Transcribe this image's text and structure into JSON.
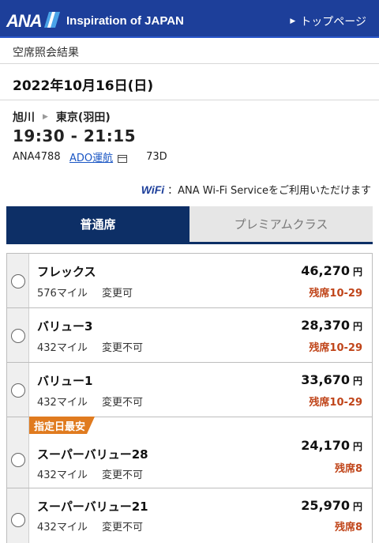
{
  "header": {
    "logo": "ANA",
    "tagline": "Inspiration of JAPAN",
    "top_link": "トップページ"
  },
  "breadcrumb": "空席照会結果",
  "date": "2022年10月16日(日)",
  "flight": {
    "from": "旭川",
    "to": "東京(羽田)",
    "times": "19:30 - 21:15",
    "number": "ANA4788",
    "operator": "ADO運航",
    "aircraft": "73D"
  },
  "wifi": {
    "logo": "WiFi",
    "text": "：ANA Wi-Fi Serviceをご利用いただけます"
  },
  "tabs": [
    {
      "label": "普通席",
      "active": true
    },
    {
      "label": "プレミアムクラス",
      "active": false
    }
  ],
  "fares": [
    {
      "name": "フレックス",
      "miles": "576マイル",
      "change": "変更可",
      "price": "46,270",
      "yen": "円",
      "seats": "残席10-29",
      "badge": ""
    },
    {
      "name": "バリュー3",
      "miles": "432マイル",
      "change": "変更不可",
      "price": "28,370",
      "yen": "円",
      "seats": "残席10-29",
      "badge": ""
    },
    {
      "name": "バリュー1",
      "miles": "432マイル",
      "change": "変更不可",
      "price": "33,670",
      "yen": "円",
      "seats": "残席10-29",
      "badge": ""
    },
    {
      "name": "スーパーバリュー28",
      "miles": "432マイル",
      "change": "変更不可",
      "price": "24,170",
      "yen": "円",
      "seats": "残席8",
      "badge": "指定日最安"
    },
    {
      "name": "スーパーバリュー21",
      "miles": "432マイル",
      "change": "変更不可",
      "price": "25,970",
      "yen": "円",
      "seats": "残席8",
      "badge": ""
    }
  ],
  "colors": {
    "header_bg": "#1d3f9a",
    "tab_active": "#0d2f66",
    "seats_text": "#c0451a",
    "badge_bg": "#e07b1f"
  }
}
